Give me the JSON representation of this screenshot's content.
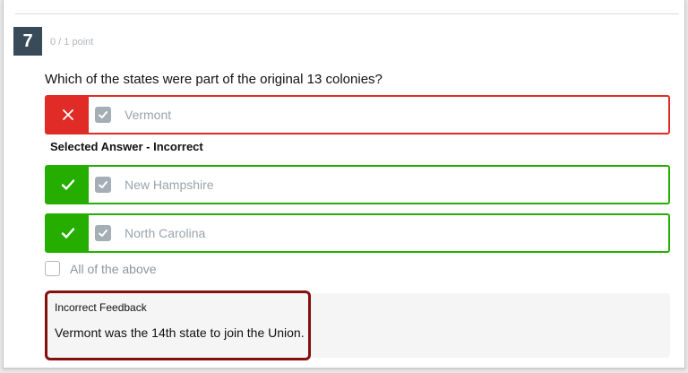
{
  "question": {
    "number": "7",
    "points": "0 / 1 point",
    "text": "Which of the states were part of the original 13 colonies?"
  },
  "answers": [
    {
      "label": "Vermont",
      "selected": true,
      "status": "incorrect",
      "indicator_icon": "x-icon"
    },
    {
      "label": "New Hampshire",
      "selected": true,
      "status": "correct",
      "indicator_icon": "check-icon"
    },
    {
      "label": "North Carolina",
      "selected": true,
      "status": "correct",
      "indicator_icon": "check-icon"
    },
    {
      "label": "All of the above",
      "selected": false,
      "status": "none"
    }
  ],
  "selected_answer_label": "Selected Answer - Incorrect",
  "feedback": {
    "title": "Incorrect Feedback",
    "text": "Vermont was the 14th state to join the Union."
  },
  "colors": {
    "incorrect": "#e02b27",
    "correct": "#25ae00",
    "question_number_bg": "#394b58",
    "feedback_highlight": "#850e0e"
  }
}
